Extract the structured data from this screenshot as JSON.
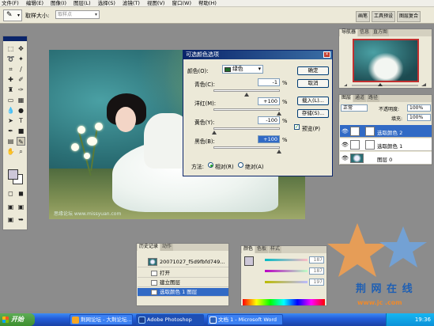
{
  "menubar": {
    "items": [
      "文件(F)",
      "编辑(E)",
      "图像(I)",
      "图层(L)",
      "选择(S)",
      "滤镜(T)",
      "视图(V)",
      "窗口(W)",
      "帮助(H)"
    ]
  },
  "options": {
    "sample_label": "取样大小:",
    "sample_value": "取样点",
    "well_tabs": [
      "画笔",
      "工具预设",
      "图层复合"
    ]
  },
  "photo": {
    "watermark": "思缘论坛 www.missyuan.com"
  },
  "dialog": {
    "title": "可选颜色选项",
    "colors_label": "颜色(O):",
    "colors_value": "绿色",
    "ok": "确定",
    "cancel": "取消",
    "load": "载入(L)...",
    "save": "存储(S)...",
    "preview_label": "预览(P)",
    "preview_checked": true,
    "method_label": "方法:",
    "method_relative": "相对(R)",
    "method_absolute": "绝对(A)",
    "channels": [
      {
        "label": "青色(C):",
        "value": "-1",
        "unit": "%",
        "position": 0.495
      },
      {
        "label": "洋红(M):",
        "value": "+100",
        "unit": "%",
        "position": 1.0
      },
      {
        "label": "黄色(Y):",
        "value": "-100",
        "unit": "%",
        "position": 0.0
      },
      {
        "label": "黑色(B):",
        "value": "+100",
        "unit": "%",
        "position": 1.0
      }
    ]
  },
  "navigator": {
    "tabs": [
      "导航器",
      "信息",
      "直方图"
    ]
  },
  "layers": {
    "tabs": [
      "图层",
      "通道",
      "路径"
    ],
    "blend_mode": "正常",
    "opacity_label": "不透明度:",
    "opacity_value": "100%",
    "fill_label": "填充:",
    "fill_value": "100%",
    "rows": [
      {
        "name": "选取颜色 2"
      },
      {
        "name": "选取颜色 1"
      },
      {
        "name": "图层 0"
      }
    ]
  },
  "history": {
    "tabs": [
      "历史记录",
      "动作"
    ],
    "snapshot": "20071027_f5d9fbfd749...",
    "rows": [
      "打开",
      "建立图层",
      "选取颜色 1 图层"
    ]
  },
  "colorpanel": {
    "tabs": [
      "颜色",
      "色板",
      "样式"
    ],
    "values": [
      "187",
      "187",
      "197"
    ]
  },
  "logo": {
    "text": "荆 网 在 线",
    "sub": "www.jc   .com"
  },
  "taskbar": {
    "start": "开始",
    "buttons": [
      "荆网论坛 - 大荆论坛...",
      "Adobe Photoshop",
      "文档 1 - Microsoft Word"
    ],
    "clock": "19:36"
  },
  "colors": {
    "selection": "#316ac5",
    "titlebar": "#0a246a",
    "dialog_bg": "#ece9d8",
    "swatch_green": "#1f6b2a",
    "foreground": "#cdc7d8"
  },
  "icons": [
    "eyedropper-icon",
    "eye-icon",
    "close-icon",
    "start-logo-icon"
  ]
}
